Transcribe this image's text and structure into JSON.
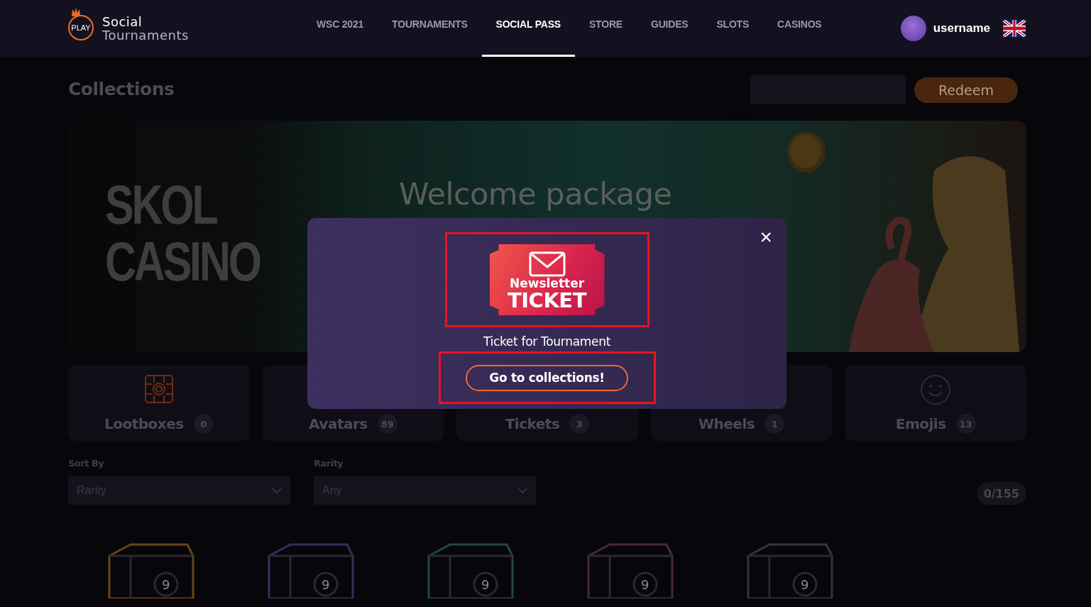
{
  "header": {
    "logo": {
      "badge": "PLAY",
      "line_1": "Social",
      "line_2": "Tournaments"
    },
    "nav": [
      {
        "label": "WSC 2021",
        "selected": false
      },
      {
        "label": "TOURNAMENTS",
        "selected": false
      },
      {
        "label": "SOCIAL PASS",
        "selected": true
      },
      {
        "label": "STORE",
        "selected": false
      },
      {
        "label": "GUIDES",
        "selected": false
      },
      {
        "label": "SLOTS",
        "selected": false
      },
      {
        "label": "CASINOS",
        "selected": false
      }
    ],
    "user": {
      "name": "username"
    }
  },
  "page": {
    "title": "Collections",
    "redeem_button": "Redeem"
  },
  "banner": {
    "brand_line_1": "SKOL",
    "brand_line_2": "CASINO",
    "title": "Welcome package"
  },
  "categories": [
    {
      "kind": "lootbox",
      "label": "Lootboxes",
      "count": "0"
    },
    {
      "kind": "avatar",
      "label": "Avatars",
      "count": "89"
    },
    {
      "kind": "ticket",
      "label": "Tickets",
      "count": "3"
    },
    {
      "kind": "wheel",
      "label": "Wheels",
      "count": "1"
    },
    {
      "kind": "emoji",
      "label": "Emojis",
      "count": "13"
    }
  ],
  "filters": [
    {
      "label": "Sort By",
      "value": "Rarity"
    },
    {
      "label": "Rarity",
      "value": "Any"
    }
  ],
  "progress": "0/155",
  "items": [
    {
      "color": "#6b4418",
      "number": "9"
    },
    {
      "color": "#3a2d5e",
      "number": "9"
    },
    {
      "color": "#1d4a42",
      "number": "9"
    },
    {
      "color": "#4a2838",
      "number": "9"
    },
    {
      "color": "#3a3338",
      "number": "9"
    }
  ],
  "modal": {
    "ticket_line_1": "Newsletter",
    "ticket_line_2": "TICKET",
    "reward": "Ticket for Tournament",
    "button": "Go to collections!",
    "close": "×"
  }
}
